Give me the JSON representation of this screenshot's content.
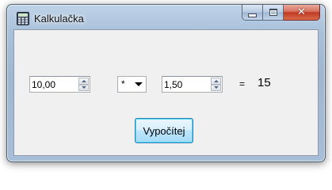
{
  "window": {
    "title": "Kalkulačka",
    "icon": "calculator-icon",
    "controls": {
      "minimize": "minimize-icon",
      "maximize": "maximize-icon",
      "close": "close-icon"
    }
  },
  "form": {
    "operand1": "10,00",
    "operator": "*",
    "operand2": "1,50",
    "equals": "=",
    "result": "15",
    "compute_label": "Vypočítej"
  },
  "colors": {
    "client_bg": "#f0f0f0",
    "button_border": "#3c7fb1",
    "close_button": "#c13a22"
  }
}
